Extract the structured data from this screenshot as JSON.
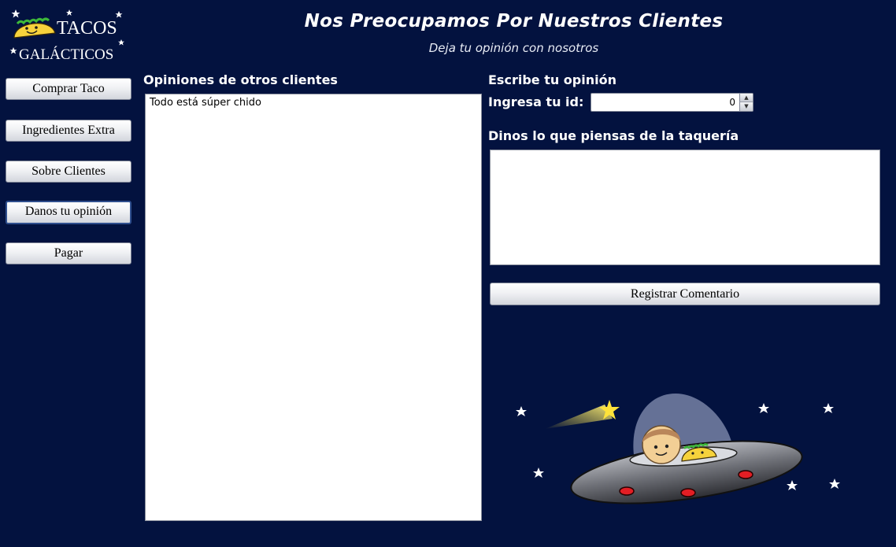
{
  "logo": {
    "line1": "TACOS",
    "line2": "GALÁCTICOS"
  },
  "header": {
    "title": "Nos Preocupamos Por Nuestros Clientes",
    "subtitle": "Deja tu opinión con nosotros"
  },
  "sidebar": {
    "items": [
      {
        "label": "Comprar Taco"
      },
      {
        "label": "Ingredientes Extra"
      },
      {
        "label": "Sobre Clientes"
      },
      {
        "label": "Danos tu opinión",
        "selected": true
      },
      {
        "label": "Pagar"
      }
    ]
  },
  "opinions": {
    "heading": "Opiniones de otros clientes",
    "items": [
      "Todo está súper chido"
    ]
  },
  "form": {
    "heading": "Escribe tu opinión",
    "id_label": "Ingresa tu id:",
    "id_value": "0",
    "comment_label": "Dinos lo que piensas de la taquería",
    "comment_value": "",
    "submit_label": "Registrar Comentario"
  },
  "colors": {
    "background": "#03123f",
    "taco": "#f6d23c",
    "star": "#ffe23a"
  },
  "icons": {
    "up": "triangle-up-icon",
    "down": "triangle-down-icon",
    "logo": "taco-logo",
    "illustration": "ufo-with-taco-astronaut"
  }
}
